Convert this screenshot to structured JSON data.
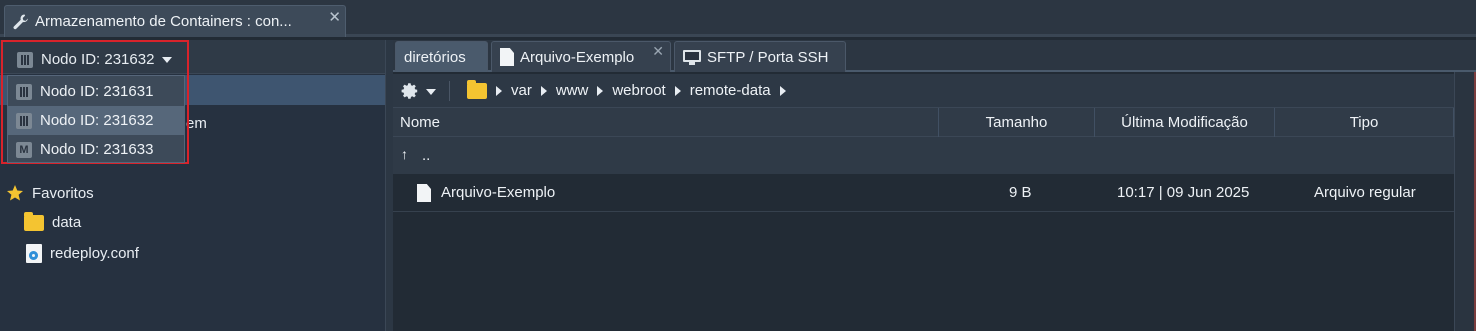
{
  "app_tab": {
    "title": "Armazenamento de Containers : con...",
    "close": "✕"
  },
  "node_selector": {
    "selected": "Nodo ID: 231632"
  },
  "dropdown": {
    "items": [
      {
        "label": "Nodo ID: 231631",
        "icon": "node-icon"
      },
      {
        "label": "Nodo ID: 231632",
        "icon": "node-icon"
      },
      {
        "label": "Nodo ID: 231633",
        "icon": "master-node-icon"
      }
    ]
  },
  "tree": {
    "partial_text": "em"
  },
  "favorites": {
    "label": "Favoritos",
    "items": [
      {
        "label": "data",
        "icon": "folder-icon"
      },
      {
        "label": "redeploy.conf",
        "icon": "config-file-icon"
      }
    ]
  },
  "tabs": [
    {
      "label": "diretórios"
    },
    {
      "label": "Arquivo-Exemplo",
      "close": "✕"
    },
    {
      "label": "SFTP / Porta SSH"
    }
  ],
  "breadcrumb": [
    "var",
    "www",
    "webroot",
    "remote-data"
  ],
  "table": {
    "headers": {
      "name": "Nome",
      "size": "Tamanho",
      "modified": "Última Modificação",
      "type": "Tipo"
    },
    "up_row": {
      "arrow": "↑",
      "label": ".."
    },
    "rows": [
      {
        "name": "Arquivo-Exemplo",
        "size": "9 B",
        "modified": "10:17 | 09 Jun 2025",
        "type": "Arquivo regular"
      }
    ]
  },
  "colors": {
    "highlight_border": "#d9232b",
    "folder": "#f4c431",
    "selected_row": "#3e5570"
  }
}
